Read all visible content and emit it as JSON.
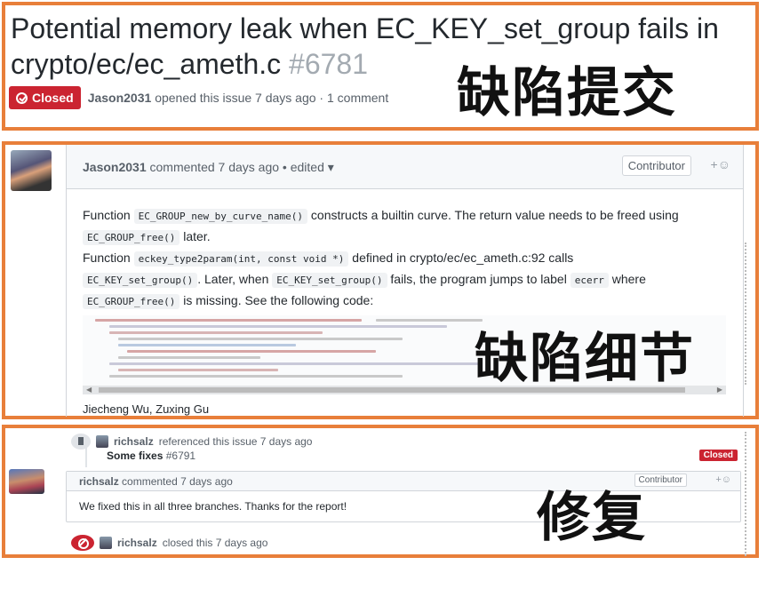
{
  "issue": {
    "title": "Potential memory leak when EC_KEY_set_group fails in crypto/ec/ec_ameth.c",
    "number": "#6781",
    "state": "Closed",
    "author": "Jason2031",
    "meta": "opened this issue 7 days ago · 1 comment"
  },
  "overlays": {
    "submit": "缺陷提交",
    "detail": "缺陷细节",
    "fix": "修复"
  },
  "comment1": {
    "author": "Jason2031",
    "action": "commented 7 days ago",
    "edited": "• edited ▾",
    "badge": "Contributor",
    "react": "+☺",
    "body": {
      "l1_a": "Function",
      "l1_code": "EC_GROUP_new_by_curve_name()",
      "l1_b": "constructs a builtin curve. The return value needs to be freed using",
      "l2_code": "EC_GROUP_free()",
      "l2_b": "later.",
      "l3_a": "Function",
      "l3_code": "eckey_type2param(int, const void *)",
      "l3_b": "defined in crypto/ec/ec_ameth.c:92 calls",
      "l4_code": "EC_KEY_set_group()",
      "l4_b": ". Later, when",
      "l4_code2": "EC_KEY_set_group()",
      "l4_c": "fails, the program jumps to label",
      "l4_code3": "ecerr",
      "l4_d": "where",
      "l5_code": "EC_GROUP_free()",
      "l5_b": "is missing. See the following code:"
    },
    "signature": "Jiecheng Wu, Zuxing Gu"
  },
  "reference": {
    "user": "richsalz",
    "action": "referenced this issue 7 days ago",
    "title": "Some fixes",
    "number": "#6791",
    "state": "Closed"
  },
  "comment2": {
    "author": "richsalz",
    "action": "commented 7 days ago",
    "badge": "Contributor",
    "react": "+☺",
    "body": "We fixed this in all three branches. Thanks for the report!"
  },
  "closed_event": {
    "user": "richsalz",
    "action": "closed this 7 days ago"
  },
  "colors": {
    "frame": "#e87f3a",
    "closed": "#cb2431"
  }
}
